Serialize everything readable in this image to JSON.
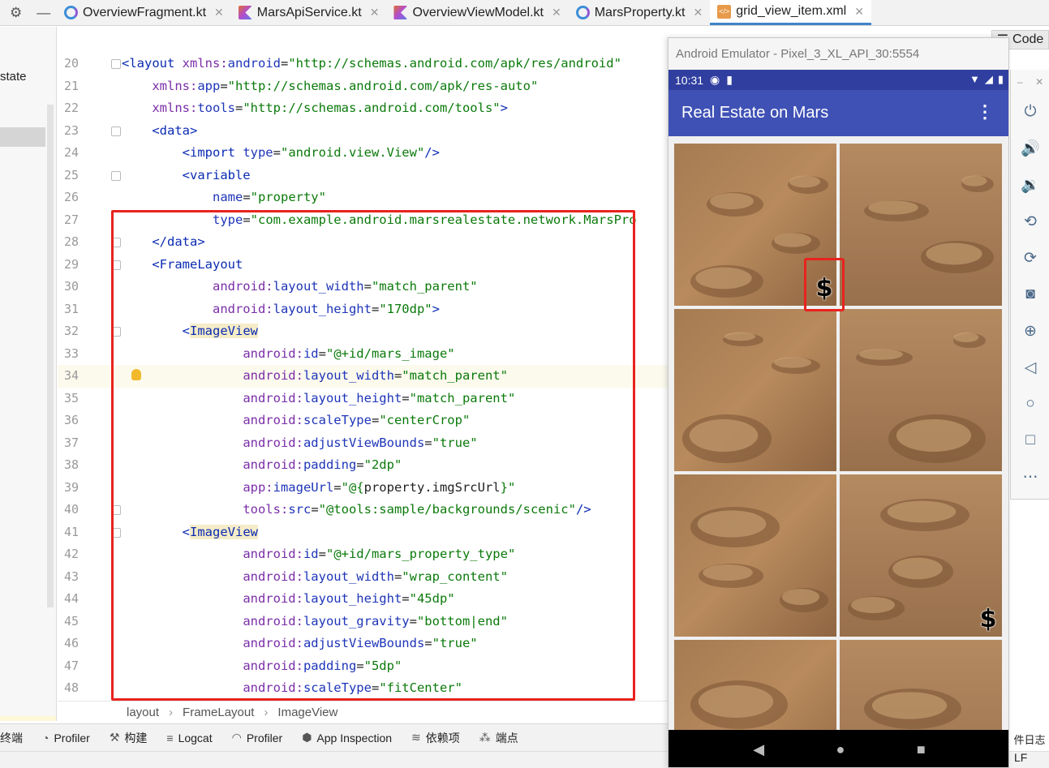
{
  "tabs": [
    {
      "label": "OverviewFragment.kt",
      "icon": "kotlin-class-icon",
      "active": false
    },
    {
      "label": "MarsApiService.kt",
      "icon": "kotlin-file-icon",
      "active": false
    },
    {
      "label": "OverviewViewModel.kt",
      "icon": "kotlin-file-icon",
      "active": false
    },
    {
      "label": "MarsProperty.kt",
      "icon": "kotlin-class-icon",
      "active": false
    },
    {
      "label": "grid_view_item.xml",
      "icon": "xml-file-icon",
      "active": true
    }
  ],
  "left_panel": {
    "partial_label": "state"
  },
  "code_view_button": "Code",
  "editor": {
    "lines": [
      {
        "n": "20",
        "tokens": [
          [
            "t-tag",
            "<layout "
          ],
          [
            "t-ns",
            "xmlns:"
          ],
          [
            "t-attr",
            "android"
          ],
          [
            "t-plain",
            "="
          ],
          [
            "t-val",
            "\"http://schemas.android.com/apk/res/android\""
          ]
        ]
      },
      {
        "n": "21",
        "tokens": [
          [
            "t-plain",
            "    "
          ],
          [
            "t-ns",
            "xmlns:"
          ],
          [
            "t-attr",
            "app"
          ],
          [
            "t-plain",
            "="
          ],
          [
            "t-val",
            "\"http://schemas.android.com/apk/res-auto\""
          ]
        ]
      },
      {
        "n": "22",
        "tokens": [
          [
            "t-plain",
            "    "
          ],
          [
            "t-ns",
            "xmlns:"
          ],
          [
            "t-attr",
            "tools"
          ],
          [
            "t-plain",
            "="
          ],
          [
            "t-val",
            "\"http://schemas.android.com/tools\""
          ],
          [
            "t-tag",
            ">"
          ]
        ]
      },
      {
        "n": "23",
        "tokens": [
          [
            "t-plain",
            "    "
          ],
          [
            "t-tag",
            "<data>"
          ]
        ]
      },
      {
        "n": "24",
        "tokens": [
          [
            "t-plain",
            "        "
          ],
          [
            "t-tag",
            "<import "
          ],
          [
            "t-attr",
            "type"
          ],
          [
            "t-plain",
            "="
          ],
          [
            "t-val",
            "\"android.view.View\""
          ],
          [
            "t-tag",
            "/>"
          ]
        ]
      },
      {
        "n": "25",
        "tokens": [
          [
            "t-plain",
            "        "
          ],
          [
            "t-tag",
            "<variable"
          ]
        ]
      },
      {
        "n": "26",
        "tokens": [
          [
            "t-plain",
            "            "
          ],
          [
            "t-attr",
            "name"
          ],
          [
            "t-plain",
            "="
          ],
          [
            "t-val",
            "\"property\""
          ]
        ]
      },
      {
        "n": "27",
        "tokens": [
          [
            "t-plain",
            "            "
          ],
          [
            "t-attr",
            "type"
          ],
          [
            "t-plain",
            "="
          ],
          [
            "t-val",
            "\"com.example.android.marsrealestate.network.MarsPro"
          ]
        ]
      },
      {
        "n": "28",
        "tokens": [
          [
            "t-plain",
            "    "
          ],
          [
            "t-tag",
            "</data>"
          ]
        ]
      },
      {
        "n": "29",
        "tokens": [
          [
            "t-plain",
            "    "
          ],
          [
            "t-tag",
            "<FrameLayout"
          ]
        ]
      },
      {
        "n": "30",
        "tokens": [
          [
            "t-plain",
            "            "
          ],
          [
            "t-ns",
            "android:"
          ],
          [
            "t-attr",
            "layout_width"
          ],
          [
            "t-plain",
            "="
          ],
          [
            "t-val",
            "\"match_parent\""
          ]
        ]
      },
      {
        "n": "31",
        "tokens": [
          [
            "t-plain",
            "            "
          ],
          [
            "t-ns",
            "android:"
          ],
          [
            "t-attr",
            "layout_height"
          ],
          [
            "t-plain",
            "="
          ],
          [
            "t-val",
            "\"170dp\""
          ],
          [
            "t-tag",
            ">"
          ]
        ]
      },
      {
        "n": "32",
        "tokens": [
          [
            "t-plain",
            "        "
          ],
          [
            "t-tag",
            "<"
          ],
          [
            "t-tag t-hl",
            "ImageView"
          ]
        ]
      },
      {
        "n": "33",
        "tokens": [
          [
            "t-plain",
            "                "
          ],
          [
            "t-ns",
            "android:"
          ],
          [
            "t-attr",
            "id"
          ],
          [
            "t-plain",
            "="
          ],
          [
            "t-val",
            "\"@+id/mars_image\""
          ]
        ]
      },
      {
        "n": "34",
        "tokens": [
          [
            "t-plain",
            "                "
          ],
          [
            "t-ns",
            "android:"
          ],
          [
            "t-attr",
            "layout_width"
          ],
          [
            "t-plain",
            "="
          ],
          [
            "t-val",
            "\"match_parent\""
          ]
        ]
      },
      {
        "n": "35",
        "tokens": [
          [
            "t-plain",
            "                "
          ],
          [
            "t-ns",
            "android:"
          ],
          [
            "t-attr",
            "layout_height"
          ],
          [
            "t-plain",
            "="
          ],
          [
            "t-val",
            "\"match_parent\""
          ]
        ]
      },
      {
        "n": "36",
        "tokens": [
          [
            "t-plain",
            "                "
          ],
          [
            "t-ns",
            "android:"
          ],
          [
            "t-attr",
            "scaleType"
          ],
          [
            "t-plain",
            "="
          ],
          [
            "t-val",
            "\"centerCrop\""
          ]
        ]
      },
      {
        "n": "37",
        "tokens": [
          [
            "t-plain",
            "                "
          ],
          [
            "t-ns",
            "android:"
          ],
          [
            "t-attr",
            "adjustViewBounds"
          ],
          [
            "t-plain",
            "="
          ],
          [
            "t-val",
            "\"true\""
          ]
        ]
      },
      {
        "n": "38",
        "tokens": [
          [
            "t-plain",
            "                "
          ],
          [
            "t-ns",
            "android:"
          ],
          [
            "t-attr",
            "padding"
          ],
          [
            "t-plain",
            "="
          ],
          [
            "t-val",
            "\"2dp\""
          ]
        ]
      },
      {
        "n": "39",
        "tokens": [
          [
            "t-plain",
            "                "
          ],
          [
            "t-ns",
            "app:"
          ],
          [
            "t-attr",
            "imageUrl"
          ],
          [
            "t-plain",
            "="
          ],
          [
            "t-val",
            "\"@{"
          ],
          [
            "t-plain",
            "property.imgSrcUrl"
          ],
          [
            "t-val",
            "}\""
          ]
        ]
      },
      {
        "n": "40",
        "tokens": [
          [
            "t-plain",
            "                "
          ],
          [
            "t-ns",
            "tools:"
          ],
          [
            "t-attr",
            "src"
          ],
          [
            "t-plain",
            "="
          ],
          [
            "t-val",
            "\"@tools:sample/backgrounds/scenic\""
          ],
          [
            "t-tag",
            "/>"
          ]
        ]
      },
      {
        "n": "41",
        "tokens": [
          [
            "t-plain",
            "        "
          ],
          [
            "t-tag",
            "<"
          ],
          [
            "t-tag t-hl",
            "ImageView"
          ]
        ]
      },
      {
        "n": "42",
        "tokens": [
          [
            "t-plain",
            "                "
          ],
          [
            "t-ns",
            "android:"
          ],
          [
            "t-attr",
            "id"
          ],
          [
            "t-plain",
            "="
          ],
          [
            "t-val",
            "\"@+id/mars_property_type\""
          ]
        ]
      },
      {
        "n": "43",
        "tokens": [
          [
            "t-plain",
            "                "
          ],
          [
            "t-ns",
            "android:"
          ],
          [
            "t-attr",
            "layout_width"
          ],
          [
            "t-plain",
            "="
          ],
          [
            "t-val",
            "\"wrap_content\""
          ]
        ]
      },
      {
        "n": "44",
        "tokens": [
          [
            "t-plain",
            "                "
          ],
          [
            "t-ns",
            "android:"
          ],
          [
            "t-attr",
            "layout_height"
          ],
          [
            "t-plain",
            "="
          ],
          [
            "t-val",
            "\"45dp\""
          ]
        ]
      },
      {
        "n": "45",
        "tokens": [
          [
            "t-plain",
            "                "
          ],
          [
            "t-ns",
            "android:"
          ],
          [
            "t-attr",
            "layout_gravity"
          ],
          [
            "t-plain",
            "="
          ],
          [
            "t-val",
            "\"bottom|end\""
          ]
        ]
      },
      {
        "n": "46",
        "tokens": [
          [
            "t-plain",
            "                "
          ],
          [
            "t-ns",
            "android:"
          ],
          [
            "t-attr",
            "adjustViewBounds"
          ],
          [
            "t-plain",
            "="
          ],
          [
            "t-val",
            "\"true\""
          ]
        ]
      },
      {
        "n": "47",
        "tokens": [
          [
            "t-plain",
            "                "
          ],
          [
            "t-ns",
            "android:"
          ],
          [
            "t-attr",
            "padding"
          ],
          [
            "t-plain",
            "="
          ],
          [
            "t-val",
            "\"5dp\""
          ]
        ]
      },
      {
        "n": "48",
        "tokens": [
          [
            "t-plain",
            "                "
          ],
          [
            "t-ns",
            "android:"
          ],
          [
            "t-attr",
            "scaleType"
          ],
          [
            "t-plain",
            "="
          ],
          [
            "t-val",
            "\"fitCenter\""
          ]
        ]
      }
    ]
  },
  "breadcrumb": [
    "layout",
    "FrameLayout",
    "ImageView"
  ],
  "bottom_tools": [
    {
      "label": "终端",
      "icon": "terminal-icon"
    },
    {
      "label": "Profiler",
      "icon": "profiler-icon"
    },
    {
      "label": "构建",
      "icon": "hammer-icon"
    },
    {
      "label": "Logcat",
      "icon": "logcat-icon"
    },
    {
      "label": "Profiler",
      "icon": "gauge-icon"
    },
    {
      "label": "App Inspection",
      "icon": "app-inspection-icon"
    },
    {
      "label": "依赖项",
      "icon": "dependencies-icon"
    },
    {
      "label": "端点",
      "icon": "endpoints-icon"
    }
  ],
  "right_edge_label": "件日志",
  "line_ending": "LF",
  "emulator": {
    "window_title": "Android Emulator - Pixel_3_XL_API_30:5554",
    "time": "10:31",
    "app_title": "Real Estate on Mars",
    "dollar_symbol": "$",
    "side_buttons": [
      "power-icon",
      "volume-up-icon",
      "volume-down-icon",
      "rotate-left-icon",
      "rotate-right-icon",
      "camera-icon",
      "zoom-icon",
      "back-icon",
      "home-icon",
      "overview-icon",
      "more-icon"
    ]
  },
  "colors": {
    "app_bar": "#3f51b5",
    "status_bar": "#303f9f",
    "highlight_box": "#e8231f"
  }
}
